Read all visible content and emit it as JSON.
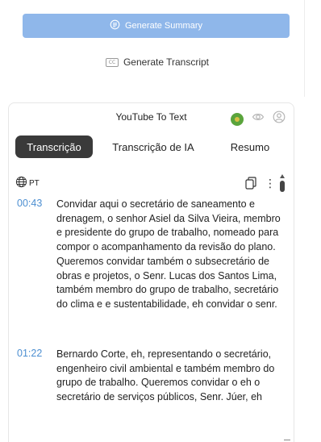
{
  "top": {
    "generate_summary_label": "Generate Summary",
    "generate_transcript_label": "Generate Transcript",
    "transcript_icon_text": "CC"
  },
  "panel": {
    "title": "YouTube To Text",
    "tabs": [
      {
        "label": "Transcrição",
        "active": true
      },
      {
        "label": "Transcrição de IA",
        "active": false
      },
      {
        "label": "Resumo",
        "active": false
      }
    ],
    "language": "PT",
    "more_glyph": "⋮",
    "segments": [
      {
        "time": "00:43",
        "text": "Convidar aqui o secretário de saneamento e drenagem, o senhor Asiel da Silva Vieira, membro e presidente do grupo de trabalho, nomeado para compor o acompanhamento da revisão do plano. Queremos convidar também o subsecretário de obras e projetos, o Senr. Lucas dos Santos Lima, também membro do grupo de trabalho, secretário do clima e e sustentabilidade, eh convidar o senr."
      },
      {
        "time": "01:22",
        "text": "Bernardo Corte, eh, representando o secretário, engenheiro civil ambiental e também membro do grupo de trabalho. Queremos convidar o eh o secretário de serviços públicos, Senr. Júer, eh"
      }
    ]
  },
  "colors": {
    "accent": "#8fb7ea",
    "timestamp": "#4d8fd1",
    "active_tab": "#3a3a3a",
    "brand": "#5aa43c"
  },
  "icons": [
    "summary-icon",
    "captions-icon",
    "brand-logo-icon",
    "eye-icon",
    "avatar-icon",
    "globe-icon",
    "copy-icon",
    "more-vertical-icon"
  ]
}
